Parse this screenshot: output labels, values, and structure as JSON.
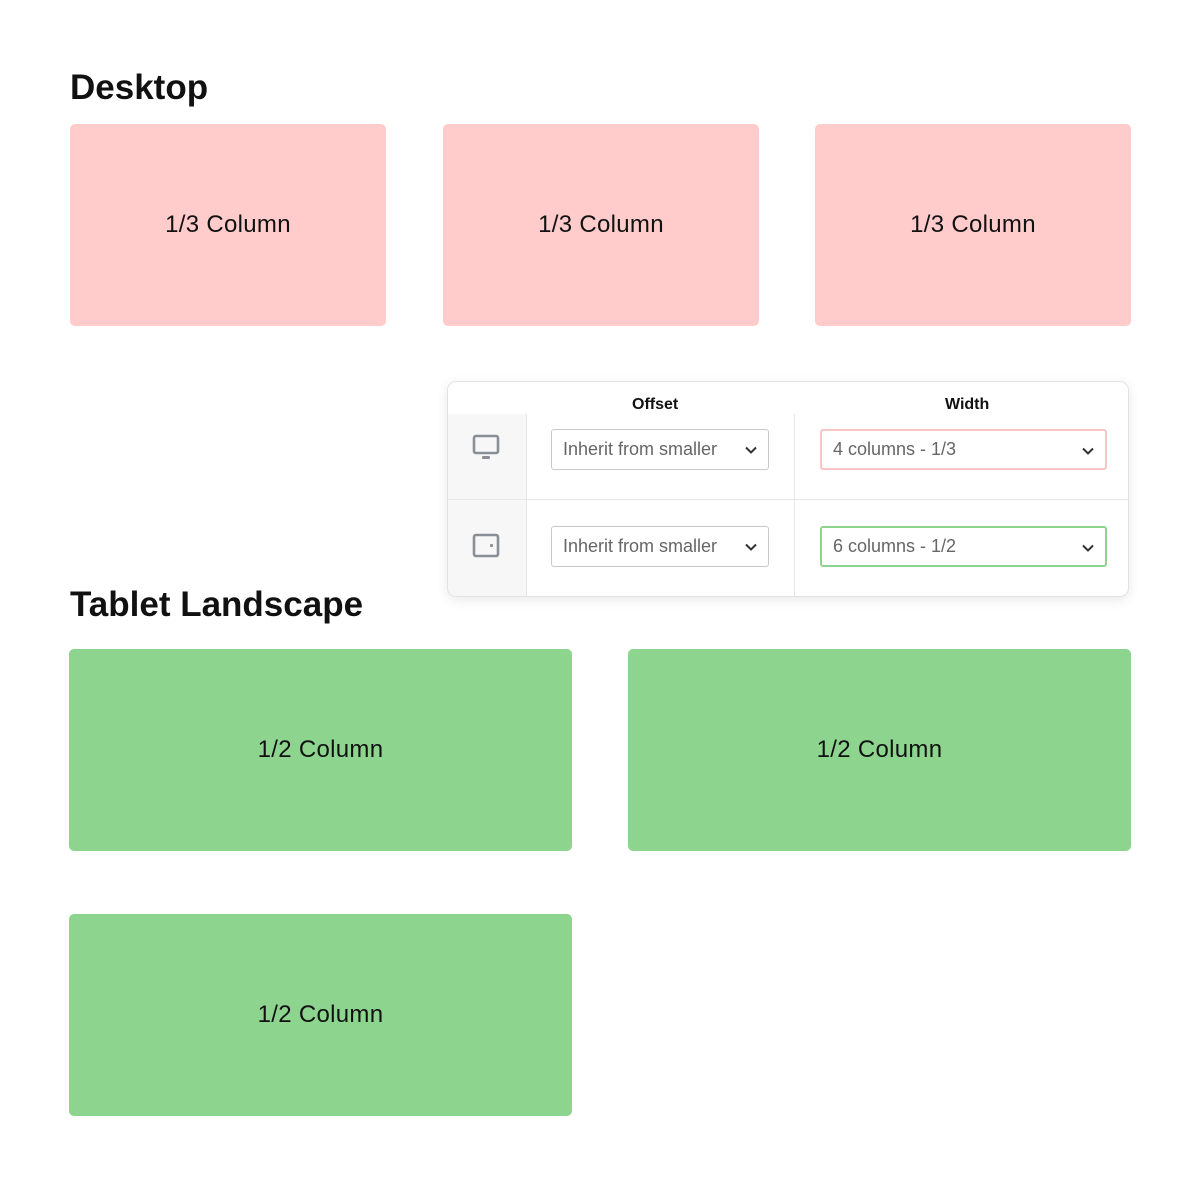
{
  "desktop": {
    "title": "Desktop",
    "columns": [
      {
        "label": "1/3 Column"
      },
      {
        "label": "1/3 Column"
      },
      {
        "label": "1/3 Column"
      }
    ],
    "color": "#ffcbcb"
  },
  "tablet": {
    "title": "Tablet Landscape",
    "columns": [
      {
        "label": "1/2 Column"
      },
      {
        "label": "1/2 Column"
      },
      {
        "label": "1/2 Column"
      }
    ],
    "color": "#8dd58f"
  },
  "panel": {
    "offset_header": "Offset",
    "width_header": "Width",
    "rows": [
      {
        "device_icon": "desktop-monitor-icon",
        "offset_value": "Inherit from smaller",
        "width_value": "4 columns - 1/3",
        "highlight": "#f8c4c4"
      },
      {
        "device_icon": "tablet-landscape-icon",
        "offset_value": "Inherit from smaller",
        "width_value": "6 columns - 1/2",
        "highlight": "#8dd58f"
      }
    ]
  }
}
